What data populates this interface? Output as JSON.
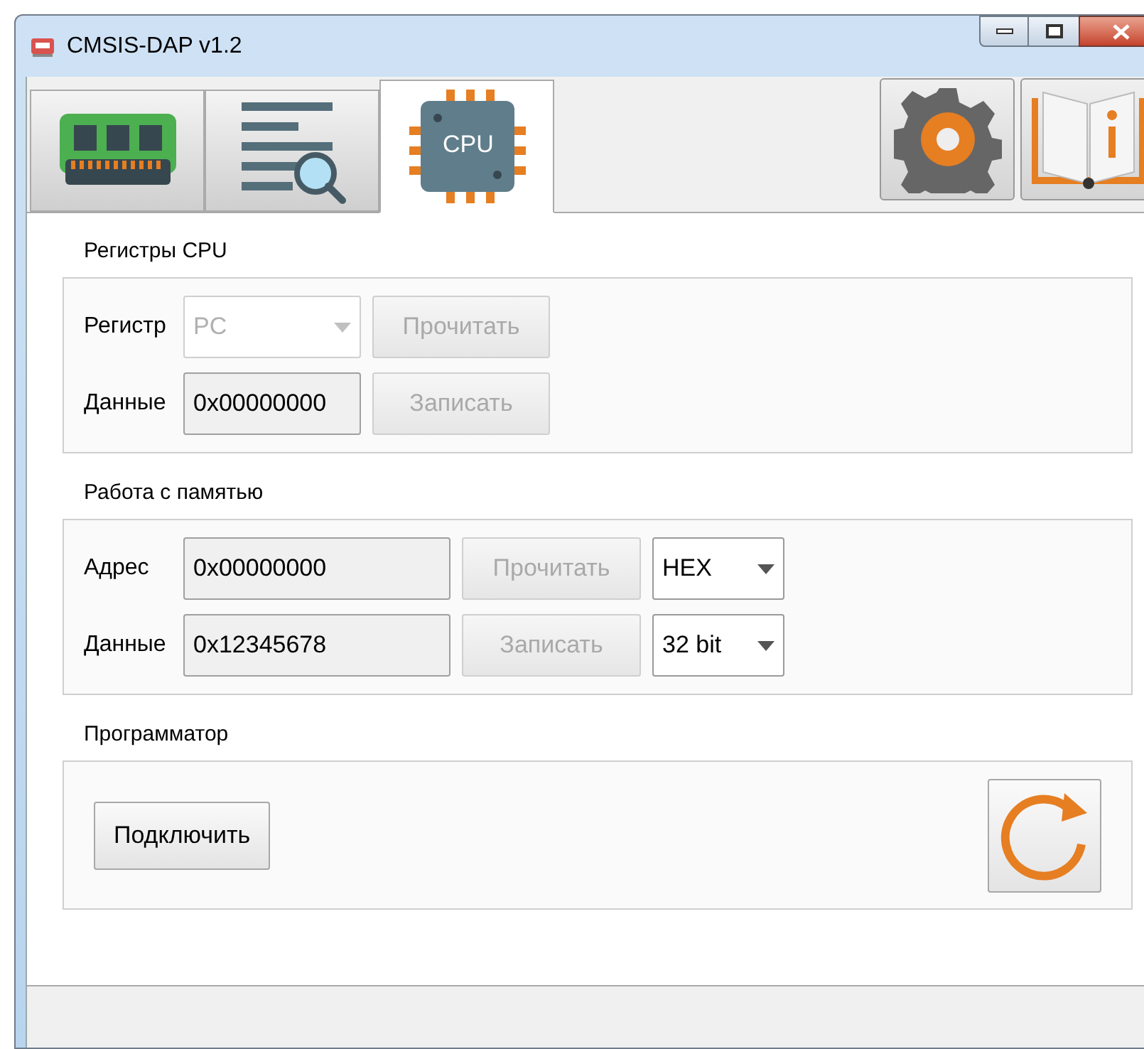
{
  "window": {
    "title": "CMSIS-DAP v1.2"
  },
  "tabs": [
    {
      "kind": "memory",
      "selected": false
    },
    {
      "kind": "listing",
      "selected": false
    },
    {
      "kind": "cpu",
      "label": "CPU",
      "selected": true
    }
  ],
  "sections": [
    {
      "kind": "registers",
      "title": "Регистры CPU",
      "rows": [
        {
          "label": "Регистр",
          "controls": [
            {
              "kind": "combo",
              "value": "PC",
              "disabled": true
            },
            {
              "kind": "button",
              "label": "Прочитать",
              "disabled": true
            }
          ]
        },
        {
          "label": "Данные",
          "controls": [
            {
              "kind": "field",
              "value": "0x00000000"
            },
            {
              "kind": "button",
              "label": "Записать",
              "disabled": true
            }
          ]
        }
      ]
    },
    {
      "kind": "memory",
      "title": "Работа с памятью",
      "rows": [
        {
          "label": "Адрес",
          "controls": [
            {
              "kind": "field",
              "value": "0x00000000"
            },
            {
              "kind": "button",
              "label": "Прочитать",
              "disabled": true
            },
            {
              "kind": "combo",
              "value": "HEX",
              "disabled": false
            }
          ]
        },
        {
          "label": "Данные",
          "controls": [
            {
              "kind": "field",
              "value": "0x12345678"
            },
            {
              "kind": "button",
              "label": "Записать",
              "disabled": true
            },
            {
              "kind": "combo",
              "value": "32 bit",
              "disabled": false
            }
          ]
        }
      ]
    },
    {
      "kind": "programmer",
      "title": "Программатор",
      "connect": {
        "label": "Подключить",
        "disabled": false
      }
    }
  ]
}
